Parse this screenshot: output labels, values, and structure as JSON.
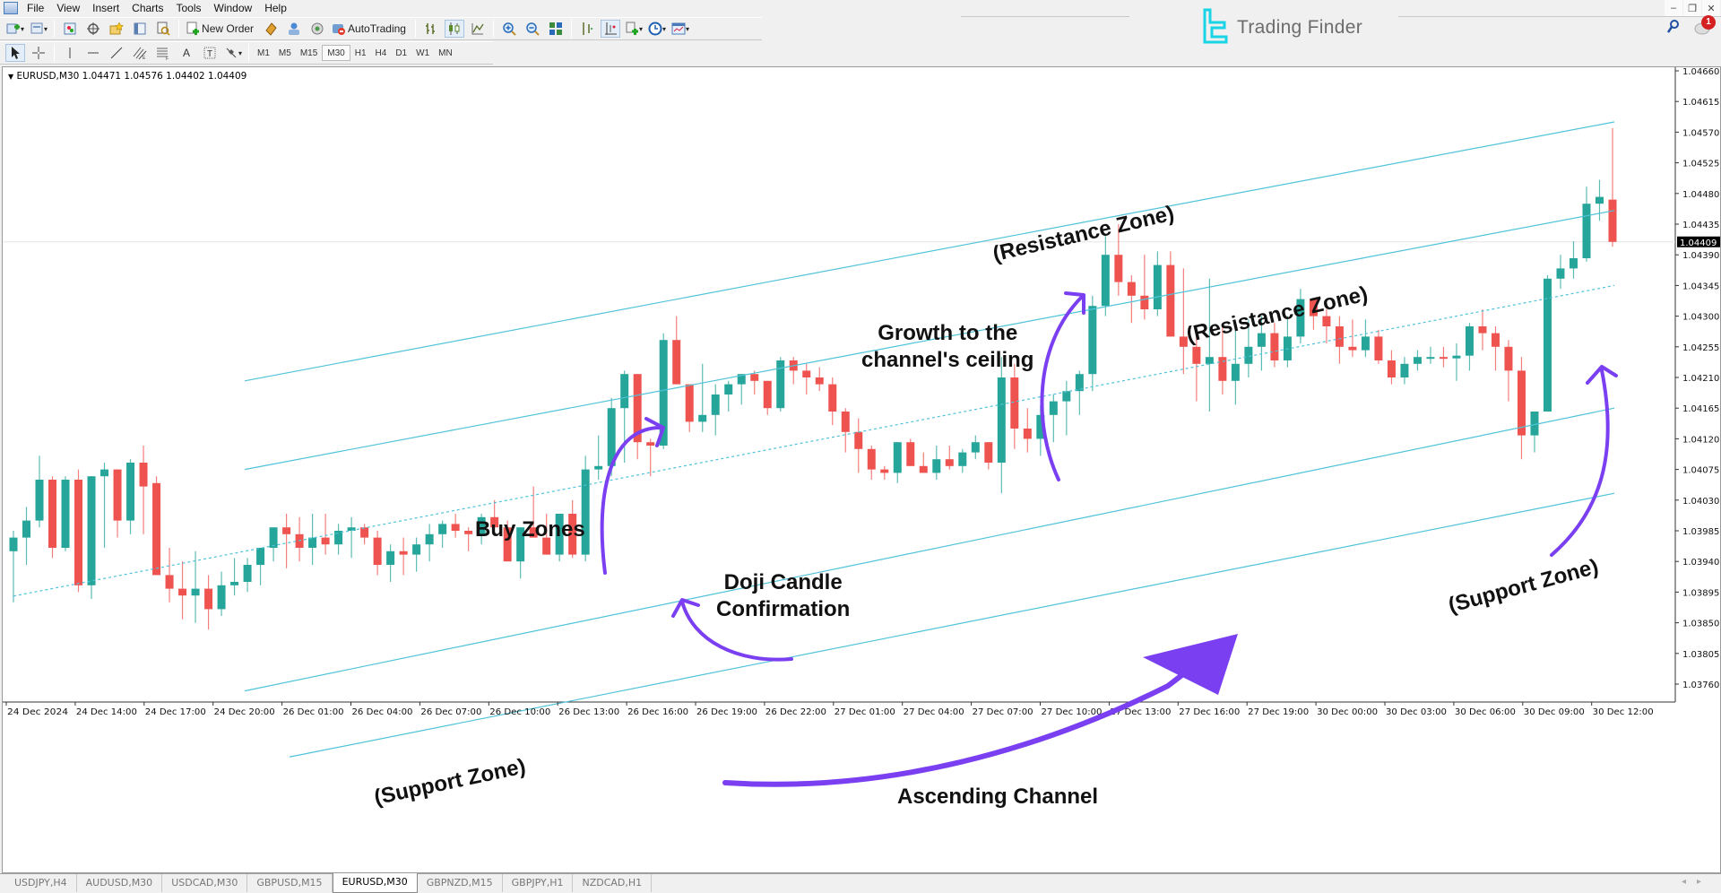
{
  "menu": [
    "File",
    "View",
    "Insert",
    "Charts",
    "Tools",
    "Window",
    "Help"
  ],
  "toolbar": {
    "new_order_label": "New Order",
    "autotrading_label": "AutoTrading",
    "timeframes": [
      "M1",
      "M5",
      "M15",
      "M30",
      "H1",
      "H4",
      "D1",
      "W1",
      "MN"
    ],
    "active_timeframe": "M30",
    "drawing_tools": [
      "cursor-icon",
      "crosshair-icon",
      "vertical-line-icon",
      "horizontal-line-icon",
      "trendline-icon",
      "fibonacci-channel-icon",
      "fibonacci-icon",
      "text-icon",
      "text-label-icon",
      "shapes-icon"
    ]
  },
  "brand": {
    "name": "Trading Finder",
    "color": "#19d3e6"
  },
  "notifications": {
    "count": "1"
  },
  "chart": {
    "header": "EURUSD,M30  1.04471 1.04576 1.04402 1.04409",
    "current_price": "1.04409"
  },
  "tabs": [
    "USDJPY,H4",
    "AUDUSD,M30",
    "USDCAD,M30",
    "GBPUSD,M15",
    "EURUSD,M30",
    "GBPNZD,M15",
    "GBPJPY,H1",
    "NZDCAD,H1"
  ],
  "active_tab": "EURUSD,M30",
  "annotations": {
    "resistance_upper": "(Resistance Zone)",
    "resistance_lower": "(Resistance Zone)",
    "growth": "Growth to the\nchannel's ceiling",
    "buy_zones": "Buy Zones",
    "doji": "Doji Candle\nConfirmation",
    "support_left": "(Support Zone)",
    "support_right": "(Support Zone)",
    "ascending": "Ascending Channel"
  },
  "chart_data": {
    "type": "candlestick",
    "symbol": "EURUSD",
    "timeframe": "M30",
    "title": "EURUSD,M30",
    "ohlc_last": {
      "open": 1.04471,
      "high": 1.04576,
      "low": 1.04402,
      "close": 1.04409
    },
    "ylim": [
      1.0373,
      1.0468
    ],
    "y_ticks": [
      "1.04660",
      "1.04615",
      "1.04570",
      "1.04525",
      "1.04480",
      "1.04435",
      "1.04390",
      "1.04345",
      "1.04300",
      "1.04255",
      "1.04210",
      "1.04165",
      "1.04120",
      "1.04075",
      "1.04030",
      "1.03985",
      "1.03940",
      "1.03895",
      "1.03850",
      "1.03805",
      "1.03760"
    ],
    "x_ticks": [
      "24 Dec 2024",
      "24 Dec 14:00",
      "24 Dec 17:00",
      "24 Dec 20:00",
      "26 Dec 01:00",
      "26 Dec 04:00",
      "26 Dec 07:00",
      "26 Dec 10:00",
      "26 Dec 13:00",
      "26 Dec 16:00",
      "26 Dec 19:00",
      "26 Dec 22:00",
      "27 Dec 01:00",
      "27 Dec 04:00",
      "27 Dec 07:00",
      "27 Dec 10:00",
      "27 Dec 13:00",
      "27 Dec 16:00",
      "27 Dec 19:00",
      "30 Dec 00:00",
      "30 Dec 03:00",
      "30 Dec 06:00",
      "30 Dec 09:00",
      "30 Dec 12:00"
    ],
    "bull_color": "#26a69a",
    "bear_color": "#ef5350",
    "channel_color": "#4fc3d9",
    "annotation_color": "#7b3ff2",
    "candles": [
      [
        1.03955,
        1.03985,
        1.0388,
        1.03975
      ],
      [
        1.03975,
        1.0402,
        1.03935,
        1.04
      ],
      [
        1.04,
        1.04095,
        1.0399,
        1.0406
      ],
      [
        1.0406,
        1.04065,
        1.03945,
        1.0396
      ],
      [
        1.0396,
        1.04065,
        1.03955,
        1.0406
      ],
      [
        1.0406,
        1.04075,
        1.03895,
        1.03905
      ],
      [
        1.03905,
        1.04005,
        1.03885,
        1.04065
      ],
      [
        1.04065,
        1.04085,
        1.0396,
        1.04075
      ],
      [
        1.04075,
        1.0405,
        1.03975,
        1.04
      ],
      [
        1.04,
        1.0409,
        1.0398,
        1.04085
      ],
      [
        1.04085,
        1.0411,
        1.0398,
        1.0405
      ],
      [
        1.04055,
        1.04065,
        1.03955,
        1.0392
      ],
      [
        1.0392,
        1.0396,
        1.0388,
        1.039
      ],
      [
        1.039,
        1.0394,
        1.03855,
        1.0389
      ],
      [
        1.0389,
        1.03955,
        1.0385,
        1.039
      ],
      [
        1.039,
        1.0392,
        1.0384,
        1.0387
      ],
      [
        1.0387,
        1.03925,
        1.0386,
        1.03905
      ],
      [
        1.03905,
        1.03945,
        1.0389,
        1.0391
      ],
      [
        1.0391,
        1.03945,
        1.03895,
        1.03935
      ],
      [
        1.03935,
        1.03955,
        1.03905,
        1.0396
      ],
      [
        1.0396,
        1.03985,
        1.0394,
        1.0399
      ],
      [
        1.0399,
        1.0401,
        1.0393,
        1.0398
      ],
      [
        1.0398,
        1.04005,
        1.0394,
        1.0396
      ],
      [
        1.0396,
        1.0401,
        1.03935,
        1.03975
      ],
      [
        1.03975,
        1.0401,
        1.0395,
        1.03965
      ],
      [
        1.03965,
        1.03995,
        1.0395,
        1.03985
      ],
      [
        1.03985,
        1.04005,
        1.03945,
        1.0399
      ],
      [
        1.0399,
        1.03995,
        1.03965,
        1.03975
      ],
      [
        1.03975,
        1.03985,
        1.0392,
        1.03935
      ],
      [
        1.03935,
        1.03965,
        1.0391,
        1.03955
      ],
      [
        1.03955,
        1.03975,
        1.0392,
        1.0395
      ],
      [
        1.0395,
        1.03975,
        1.03925,
        1.03965
      ],
      [
        1.03965,
        1.03995,
        1.0394,
        1.0398
      ],
      [
        1.0398,
        1.04,
        1.0396,
        1.03995
      ],
      [
        1.03995,
        1.0401,
        1.03975,
        1.03985
      ],
      [
        1.03985,
        1.0399,
        1.03955,
        1.0398
      ],
      [
        1.0398,
        1.0401,
        1.03965,
        1.04005
      ],
      [
        1.04005,
        1.0403,
        1.0399,
        1.0399
      ],
      [
        1.0399,
        1.04,
        1.0395,
        1.0394
      ],
      [
        1.0394,
        1.0396,
        1.03915,
        1.0399
      ],
      [
        1.0399,
        1.0405,
        1.0398,
        1.03975
      ],
      [
        1.03975,
        1.0401,
        1.0396,
        1.0395
      ],
      [
        1.0395,
        1.03985,
        1.0394,
        1.0401
      ],
      [
        1.0401,
        1.0403,
        1.03945,
        1.0395
      ],
      [
        1.0395,
        1.04095,
        1.0394,
        1.04075
      ],
      [
        1.04075,
        1.04125,
        1.0406,
        1.0408
      ],
      [
        1.0408,
        1.0418,
        1.04065,
        1.04165
      ],
      [
        1.04165,
        1.0422,
        1.04085,
        1.04215
      ],
      [
        1.04215,
        1.04215,
        1.0409,
        1.04115
      ],
      [
        1.04115,
        1.0412,
        1.04065,
        1.0411
      ],
      [
        1.0411,
        1.04275,
        1.04105,
        1.04265
      ],
      [
        1.04265,
        1.043,
        1.042,
        1.042
      ],
      [
        1.042,
        1.042,
        1.0413,
        1.04145
      ],
      [
        1.04145,
        1.0423,
        1.0413,
        1.04155
      ],
      [
        1.04155,
        1.042,
        1.04125,
        1.04185
      ],
      [
        1.04185,
        1.04205,
        1.0416,
        1.042
      ],
      [
        1.042,
        1.04215,
        1.0417,
        1.04215
      ],
      [
        1.04215,
        1.0422,
        1.04185,
        1.04205
      ],
      [
        1.04205,
        1.042,
        1.04155,
        1.04165
      ],
      [
        1.04165,
        1.0424,
        1.0416,
        1.04235
      ],
      [
        1.04235,
        1.0424,
        1.042,
        1.0422
      ],
      [
        1.0422,
        1.0423,
        1.04185,
        1.0421
      ],
      [
        1.0421,
        1.04225,
        1.0419,
        1.042
      ],
      [
        1.042,
        1.0421,
        1.0414,
        1.0416
      ],
      [
        1.0416,
        1.04165,
        1.041,
        1.0413
      ],
      [
        1.0413,
        1.0415,
        1.0407,
        1.04105
      ],
      [
        1.04105,
        1.0411,
        1.0406,
        1.04075
      ],
      [
        1.04075,
        1.0408,
        1.0406,
        1.0407
      ],
      [
        1.0407,
        1.0411,
        1.04055,
        1.04115
      ],
      [
        1.04115,
        1.0412,
        1.0408,
        1.0408
      ],
      [
        1.0408,
        1.041,
        1.0407,
        1.0407
      ],
      [
        1.0407,
        1.0411,
        1.0406,
        1.0409
      ],
      [
        1.0409,
        1.0411,
        1.04075,
        1.0408
      ],
      [
        1.0408,
        1.04105,
        1.0407,
        1.041
      ],
      [
        1.041,
        1.04125,
        1.0409,
        1.04115
      ],
      [
        1.04115,
        1.0411,
        1.04075,
        1.04085
      ],
      [
        1.04085,
        1.0424,
        1.0404,
        1.0421
      ],
      [
        1.0421,
        1.0423,
        1.04105,
        1.04135
      ],
      [
        1.04135,
        1.04165,
        1.041,
        1.0412
      ],
      [
        1.0412,
        1.0417,
        1.04095,
        1.04155
      ],
      [
        1.04155,
        1.04185,
        1.04115,
        1.04175
      ],
      [
        1.04175,
        1.04205,
        1.04125,
        1.0419
      ],
      [
        1.0419,
        1.0422,
        1.04155,
        1.04215
      ],
      [
        1.04215,
        1.0433,
        1.0419,
        1.04315
      ],
      [
        1.04315,
        1.0442,
        1.043,
        1.0439
      ],
      [
        1.0439,
        1.04435,
        1.0433,
        1.0435
      ],
      [
        1.0435,
        1.0436,
        1.0429,
        1.0433
      ],
      [
        1.0433,
        1.0439,
        1.04295,
        1.0431
      ],
      [
        1.0431,
        1.04395,
        1.043,
        1.04375
      ],
      [
        1.04375,
        1.04395,
        1.0427,
        1.0427
      ],
      [
        1.0427,
        1.0437,
        1.04215,
        1.04255
      ],
      [
        1.04255,
        1.0427,
        1.04175,
        1.0423
      ],
      [
        1.0423,
        1.04355,
        1.0416,
        1.0424
      ],
      [
        1.0424,
        1.0429,
        1.04185,
        1.04205
      ],
      [
        1.04205,
        1.0429,
        1.0417,
        1.0423
      ],
      [
        1.0423,
        1.04295,
        1.0421,
        1.04255
      ],
      [
        1.04255,
        1.043,
        1.0422,
        1.04275
      ],
      [
        1.04275,
        1.0429,
        1.04225,
        1.04235
      ],
      [
        1.04235,
        1.043,
        1.04225,
        1.0427
      ],
      [
        1.0427,
        1.0434,
        1.0426,
        1.04325
      ],
      [
        1.04325,
        1.04315,
        1.0428,
        1.043
      ],
      [
        1.043,
        1.0431,
        1.0426,
        1.04285
      ],
      [
        1.04285,
        1.043,
        1.0423,
        1.04255
      ],
      [
        1.04255,
        1.04295,
        1.0424,
        1.0425
      ],
      [
        1.0425,
        1.04295,
        1.0424,
        1.0427
      ],
      [
        1.0427,
        1.0428,
        1.0423,
        1.04235
      ],
      [
        1.04235,
        1.0425,
        1.042,
        1.0421
      ],
      [
        1.0421,
        1.0424,
        1.042,
        1.0423
      ],
      [
        1.0423,
        1.0425,
        1.0422,
        1.0424
      ],
      [
        1.0424,
        1.04255,
        1.0423,
        1.0424
      ],
      [
        1.0424,
        1.04255,
        1.04225,
        1.04238
      ],
      [
        1.04238,
        1.0426,
        1.04205,
        1.04242
      ],
      [
        1.04242,
        1.0429,
        1.0422,
        1.04285
      ],
      [
        1.04285,
        1.0431,
        1.0425,
        1.04275
      ],
      [
        1.04275,
        1.04285,
        1.0422,
        1.04255
      ],
      [
        1.04255,
        1.04265,
        1.04175,
        1.0422
      ],
      [
        1.0422,
        1.0424,
        1.0409,
        1.04125
      ],
      [
        1.04125,
        1.0413,
        1.041,
        1.0416
      ],
      [
        1.0416,
        1.0436,
        1.0416,
        1.04355
      ],
      [
        1.04355,
        1.0439,
        1.0434,
        1.0437
      ],
      [
        1.0437,
        1.0441,
        1.04355,
        1.04385
      ],
      [
        1.04385,
        1.0449,
        1.0438,
        1.04465
      ],
      [
        1.04465,
        1.045,
        1.0444,
        1.04475
      ],
      [
        1.04471,
        1.04576,
        1.04402,
        1.04409
      ]
    ],
    "channel_lines": [
      {
        "name": "channel-top",
        "style": "solid",
        "start_price": 1.04205,
        "end_price": 1.04585
      },
      {
        "name": "channel-upper",
        "style": "solid",
        "start_price": 1.04075,
        "end_price": 1.04455
      },
      {
        "name": "channel-mid",
        "style": "dashed",
        "start_price": 1.03955,
        "end_price": 1.04345
      },
      {
        "name": "channel-lower",
        "style": "solid",
        "start_price": 1.0375,
        "end_price": 1.04165
      },
      {
        "name": "channel-bottom",
        "style": "solid",
        "start_price": 1.0364,
        "end_price": 1.0404
      }
    ]
  }
}
